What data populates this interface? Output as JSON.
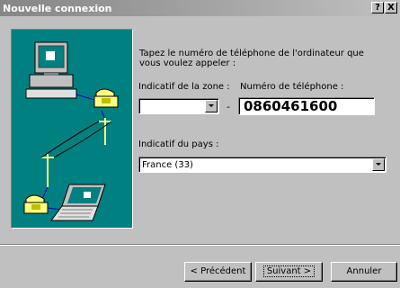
{
  "window": {
    "title": "Nouvelle connexion",
    "help_button": "?",
    "close_button": "X"
  },
  "form": {
    "instructions": "Tapez le numéro de téléphone de l'ordinateur que vous voulez appeler :",
    "area_code_label": "Indicatif de la zone :",
    "area_code_value": "",
    "dash": "-",
    "phone_label": "Numéro de téléphone :",
    "phone_value": "0860461600",
    "country_label": "Indicatif du pays :",
    "country_value": "France (33)"
  },
  "buttons": {
    "back": "< Précédent",
    "next": "Suivant >",
    "cancel": "Annuler"
  },
  "colors": {
    "illustration_bg": "#008080",
    "titlebar_start": "#868686",
    "dialog_bg": "#c0c0c0"
  },
  "icons": [
    "desktop-computer-icon",
    "telephone-icon",
    "telephone-pole-icon",
    "laptop-computer-icon"
  ]
}
